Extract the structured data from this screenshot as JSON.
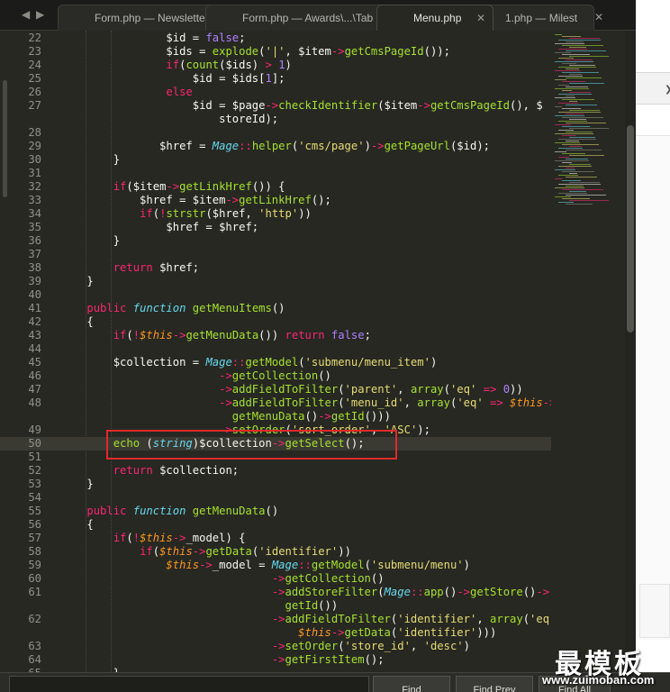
{
  "tabs": [
    {
      "label": "Form.php — Newsletter\\...\\Tab",
      "active": false
    },
    {
      "label": "Form.php — Awards\\...\\Tab",
      "active": false
    },
    {
      "label": "Menu.php",
      "active": true
    },
    {
      "label": "1.php — Milest",
      "active": false
    }
  ],
  "icons": {
    "back": "◀",
    "forward": "▶",
    "close": "✕",
    "caret": "❯"
  },
  "find": {
    "find_label": "Find",
    "find_prev_label": "Find Prev",
    "find_all_label": "Find All"
  },
  "watermark": {
    "text": "最模板",
    "url": "www.zuimoban.com"
  },
  "colors": {
    "keyword": "#f92672",
    "string": "#e6db74",
    "number": "#ae81ff",
    "function": "#a6e22e",
    "type": "#66d9ef",
    "this": "#fd971f",
    "highlight_box": "#e02a2a"
  },
  "lines": [
    {
      "n": "22",
      "t": [
        [
          "tx",
          "                $id = "
        ],
        [
          "nm",
          "false"
        ],
        [
          "tx",
          ";"
        ]
      ]
    },
    {
      "n": "23",
      "t": [
        [
          "tx",
          "                $ids = "
        ],
        [
          "fn",
          "explode"
        ],
        [
          "tx",
          "("
        ],
        [
          "st",
          "'|'"
        ],
        [
          "tx",
          ", $item"
        ],
        [
          "kw",
          "->"
        ],
        [
          "fn",
          "getCmsPageId"
        ],
        [
          "tx",
          "());"
        ]
      ]
    },
    {
      "n": "24",
      "t": [
        [
          "tx",
          "                "
        ],
        [
          "kw",
          "if"
        ],
        [
          "tx",
          "("
        ],
        [
          "fn",
          "count"
        ],
        [
          "tx",
          "($ids) "
        ],
        [
          "kw",
          ">"
        ],
        [
          "tx",
          " "
        ],
        [
          "nm",
          "1"
        ],
        [
          "tx",
          ")"
        ]
      ]
    },
    {
      "n": "25",
      "t": [
        [
          "tx",
          "                    $id = $ids["
        ],
        [
          "nm",
          "1"
        ],
        [
          "tx",
          "];"
        ]
      ]
    },
    {
      "n": "26",
      "t": [
        [
          "tx",
          "                "
        ],
        [
          "kw",
          "else"
        ]
      ]
    },
    {
      "n": "27",
      "t": [
        [
          "tx",
          "                    $id = $page"
        ],
        [
          "kw",
          "->"
        ],
        [
          "fn",
          "checkIdentifier"
        ],
        [
          "tx",
          "($item"
        ],
        [
          "kw",
          "->"
        ],
        [
          "fn",
          "getCmsPageId"
        ],
        [
          "tx",
          "(), $"
        ]
      ]
    },
    {
      "n": "",
      "t": [
        [
          "tx",
          "                        storeId);"
        ]
      ]
    },
    {
      "n": "28",
      "t": []
    },
    {
      "n": "29",
      "t": [
        [
          "tx",
          "               $href = "
        ],
        [
          "ty",
          "Mage"
        ],
        [
          "kw",
          "::"
        ],
        [
          "fn",
          "helper"
        ],
        [
          "tx",
          "("
        ],
        [
          "st",
          "'cms/page'"
        ],
        [
          "tx",
          ")"
        ],
        [
          "kw",
          "->"
        ],
        [
          "fn",
          "getPageUrl"
        ],
        [
          "tx",
          "($id);"
        ]
      ]
    },
    {
      "n": "30",
      "t": [
        [
          "tx",
          "        }"
        ]
      ]
    },
    {
      "n": "31",
      "t": []
    },
    {
      "n": "32",
      "t": [
        [
          "tx",
          "        "
        ],
        [
          "kw",
          "if"
        ],
        [
          "tx",
          "($item"
        ],
        [
          "kw",
          "->"
        ],
        [
          "fn",
          "getLinkHref"
        ],
        [
          "tx",
          "()) {"
        ]
      ]
    },
    {
      "n": "33",
      "t": [
        [
          "tx",
          "            $href = $item"
        ],
        [
          "kw",
          "->"
        ],
        [
          "fn",
          "getLinkHref"
        ],
        [
          "tx",
          "();"
        ]
      ]
    },
    {
      "n": "34",
      "t": [
        [
          "tx",
          "            "
        ],
        [
          "kw",
          "if"
        ],
        [
          "tx",
          "("
        ],
        [
          "kw",
          "!"
        ],
        [
          "fn",
          "strstr"
        ],
        [
          "tx",
          "($href, "
        ],
        [
          "st",
          "'http'"
        ],
        [
          "tx",
          "))"
        ]
      ]
    },
    {
      "n": "35",
      "t": [
        [
          "tx",
          "                $href = $href;"
        ]
      ]
    },
    {
      "n": "36",
      "t": [
        [
          "tx",
          "        }"
        ]
      ]
    },
    {
      "n": "37",
      "t": []
    },
    {
      "n": "38",
      "t": [
        [
          "tx",
          "        "
        ],
        [
          "kw",
          "return"
        ],
        [
          "tx",
          " $href;"
        ]
      ]
    },
    {
      "n": "39",
      "t": [
        [
          "tx",
          "    }"
        ]
      ]
    },
    {
      "n": "40",
      "t": []
    },
    {
      "n": "41",
      "t": [
        [
          "tx",
          "    "
        ],
        [
          "kw",
          "public"
        ],
        [
          "tx",
          " "
        ],
        [
          "ty",
          "function"
        ],
        [
          "tx",
          " "
        ],
        [
          "fn",
          "getMenuItems"
        ],
        [
          "tx",
          "()"
        ]
      ]
    },
    {
      "n": "42",
      "t": [
        [
          "tx",
          "    {"
        ]
      ]
    },
    {
      "n": "43",
      "t": [
        [
          "tx",
          "        "
        ],
        [
          "kw",
          "if"
        ],
        [
          "tx",
          "("
        ],
        [
          "kw",
          "!"
        ],
        [
          "th",
          "$this"
        ],
        [
          "kw",
          "->"
        ],
        [
          "fn",
          "getMenuData"
        ],
        [
          "tx",
          "()) "
        ],
        [
          "kw",
          "return"
        ],
        [
          "tx",
          " "
        ],
        [
          "nm",
          "false"
        ],
        [
          "tx",
          ";"
        ]
      ]
    },
    {
      "n": "44",
      "t": []
    },
    {
      "n": "45",
      "t": [
        [
          "tx",
          "        $collection = "
        ],
        [
          "ty",
          "Mage"
        ],
        [
          "kw",
          "::"
        ],
        [
          "fn",
          "getModel"
        ],
        [
          "tx",
          "("
        ],
        [
          "st",
          "'submenu/menu_item'"
        ],
        [
          "tx",
          ")"
        ]
      ]
    },
    {
      "n": "46",
      "t": [
        [
          "tx",
          "                        "
        ],
        [
          "kw",
          "->"
        ],
        [
          "fn",
          "getCollection"
        ],
        [
          "tx",
          "()"
        ]
      ]
    },
    {
      "n": "47",
      "t": [
        [
          "tx",
          "                        "
        ],
        [
          "kw",
          "->"
        ],
        [
          "fn",
          "addFieldToFilter"
        ],
        [
          "tx",
          "("
        ],
        [
          "st",
          "'parent'"
        ],
        [
          "tx",
          ", "
        ],
        [
          "fn",
          "array"
        ],
        [
          "tx",
          "("
        ],
        [
          "st",
          "'eq'"
        ],
        [
          "tx",
          " "
        ],
        [
          "kw",
          "=>"
        ],
        [
          "tx",
          " "
        ],
        [
          "nm",
          "0"
        ],
        [
          "tx",
          "))"
        ]
      ]
    },
    {
      "n": "48",
      "t": [
        [
          "tx",
          "                        "
        ],
        [
          "kw",
          "->"
        ],
        [
          "fn",
          "addFieldToFilter"
        ],
        [
          "tx",
          "("
        ],
        [
          "st",
          "'menu_id'"
        ],
        [
          "tx",
          ", "
        ],
        [
          "fn",
          "array"
        ],
        [
          "tx",
          "("
        ],
        [
          "st",
          "'eq'"
        ],
        [
          "tx",
          " "
        ],
        [
          "kw",
          "=>"
        ],
        [
          "tx",
          " "
        ],
        [
          "th",
          "$this"
        ],
        [
          "kw",
          "->"
        ]
      ]
    },
    {
      "n": "",
      "t": [
        [
          "tx",
          "                          "
        ],
        [
          "fn",
          "getMenuData"
        ],
        [
          "tx",
          "()"
        ],
        [
          "kw",
          "->"
        ],
        [
          "fn",
          "getId"
        ],
        [
          "tx",
          "()))"
        ]
      ]
    },
    {
      "n": "49",
      "t": [
        [
          "tx",
          "                        "
        ],
        [
          "kw",
          "->"
        ],
        [
          "fn",
          "setOrder"
        ],
        [
          "tx",
          "("
        ],
        [
          "st",
          "'sort_order'"
        ],
        [
          "tx",
          ", "
        ],
        [
          "st",
          "'ASC'"
        ],
        [
          "tx",
          ");"
        ]
      ]
    },
    {
      "n": "50",
      "t": [
        [
          "tx",
          "        "
        ],
        [
          "fn",
          "echo"
        ],
        [
          "tx",
          " ("
        ],
        [
          "ty",
          "string"
        ],
        [
          "tx",
          ")$collection"
        ],
        [
          "kw",
          "->"
        ],
        [
          "fn",
          "getSelect"
        ],
        [
          "tx",
          "();"
        ]
      ],
      "hl": true
    },
    {
      "n": "51",
      "t": []
    },
    {
      "n": "52",
      "t": [
        [
          "tx",
          "        "
        ],
        [
          "kw",
          "return"
        ],
        [
          "tx",
          " $collection;"
        ]
      ]
    },
    {
      "n": "53",
      "t": [
        [
          "tx",
          "    }"
        ]
      ]
    },
    {
      "n": "54",
      "t": []
    },
    {
      "n": "55",
      "t": [
        [
          "tx",
          "    "
        ],
        [
          "kw",
          "public"
        ],
        [
          "tx",
          " "
        ],
        [
          "ty",
          "function"
        ],
        [
          "tx",
          " "
        ],
        [
          "fn",
          "getMenuData"
        ],
        [
          "tx",
          "()"
        ]
      ]
    },
    {
      "n": "56",
      "t": [
        [
          "tx",
          "    {"
        ]
      ]
    },
    {
      "n": "57",
      "t": [
        [
          "tx",
          "        "
        ],
        [
          "kw",
          "if"
        ],
        [
          "tx",
          "("
        ],
        [
          "kw",
          "!"
        ],
        [
          "th",
          "$this"
        ],
        [
          "kw",
          "->"
        ],
        [
          "tx",
          "_model) {"
        ]
      ]
    },
    {
      "n": "58",
      "t": [
        [
          "tx",
          "            "
        ],
        [
          "kw",
          "if"
        ],
        [
          "tx",
          "("
        ],
        [
          "th",
          "$this"
        ],
        [
          "kw",
          "->"
        ],
        [
          "fn",
          "getData"
        ],
        [
          "tx",
          "("
        ],
        [
          "st",
          "'identifier'"
        ],
        [
          "tx",
          "))"
        ]
      ]
    },
    {
      "n": "59",
      "t": [
        [
          "tx",
          "                "
        ],
        [
          "th",
          "$this"
        ],
        [
          "kw",
          "->"
        ],
        [
          "tx",
          "_model = "
        ],
        [
          "ty",
          "Mage"
        ],
        [
          "kw",
          "::"
        ],
        [
          "fn",
          "getModel"
        ],
        [
          "tx",
          "("
        ],
        [
          "st",
          "'submenu/menu'"
        ],
        [
          "tx",
          ")"
        ]
      ]
    },
    {
      "n": "60",
      "t": [
        [
          "tx",
          "                                "
        ],
        [
          "kw",
          "->"
        ],
        [
          "fn",
          "getCollection"
        ],
        [
          "tx",
          "()"
        ]
      ]
    },
    {
      "n": "61",
      "t": [
        [
          "tx",
          "                                "
        ],
        [
          "kw",
          "->"
        ],
        [
          "fn",
          "addStoreFilter"
        ],
        [
          "tx",
          "("
        ],
        [
          "ty",
          "Mage"
        ],
        [
          "kw",
          "::"
        ],
        [
          "fn",
          "app"
        ],
        [
          "tx",
          "()"
        ],
        [
          "kw",
          "->"
        ],
        [
          "fn",
          "getStore"
        ],
        [
          "tx",
          "()"
        ],
        [
          "kw",
          "->"
        ]
      ]
    },
    {
      "n": "",
      "t": [
        [
          "tx",
          "                                  "
        ],
        [
          "fn",
          "getId"
        ],
        [
          "tx",
          "())"
        ]
      ]
    },
    {
      "n": "62",
      "t": [
        [
          "tx",
          "                                "
        ],
        [
          "kw",
          "->"
        ],
        [
          "fn",
          "addFieldToFilter"
        ],
        [
          "tx",
          "("
        ],
        [
          "st",
          "'identifier'"
        ],
        [
          "tx",
          ", "
        ],
        [
          "fn",
          "array"
        ],
        [
          "tx",
          "("
        ],
        [
          "st",
          "'eq'"
        ],
        [
          "tx",
          " "
        ],
        [
          "kw",
          "=>"
        ]
      ]
    },
    {
      "n": "",
      "t": [
        [
          "tx",
          "                                    "
        ],
        [
          "th",
          "$this"
        ],
        [
          "kw",
          "->"
        ],
        [
          "fn",
          "getData"
        ],
        [
          "tx",
          "("
        ],
        [
          "st",
          "'identifier'"
        ],
        [
          "tx",
          ")))"
        ]
      ]
    },
    {
      "n": "63",
      "t": [
        [
          "tx",
          "                                "
        ],
        [
          "kw",
          "->"
        ],
        [
          "fn",
          "setOrder"
        ],
        [
          "tx",
          "("
        ],
        [
          "st",
          "'store_id'"
        ],
        [
          "tx",
          ", "
        ],
        [
          "st",
          "'desc'"
        ],
        [
          "tx",
          ")"
        ]
      ]
    },
    {
      "n": "64",
      "t": [
        [
          "tx",
          "                                "
        ],
        [
          "kw",
          "->"
        ],
        [
          "fn",
          "getFirstItem"
        ],
        [
          "tx",
          "();"
        ]
      ]
    },
    {
      "n": "65",
      "t": [
        [
          "tx",
          "        }"
        ]
      ]
    }
  ]
}
